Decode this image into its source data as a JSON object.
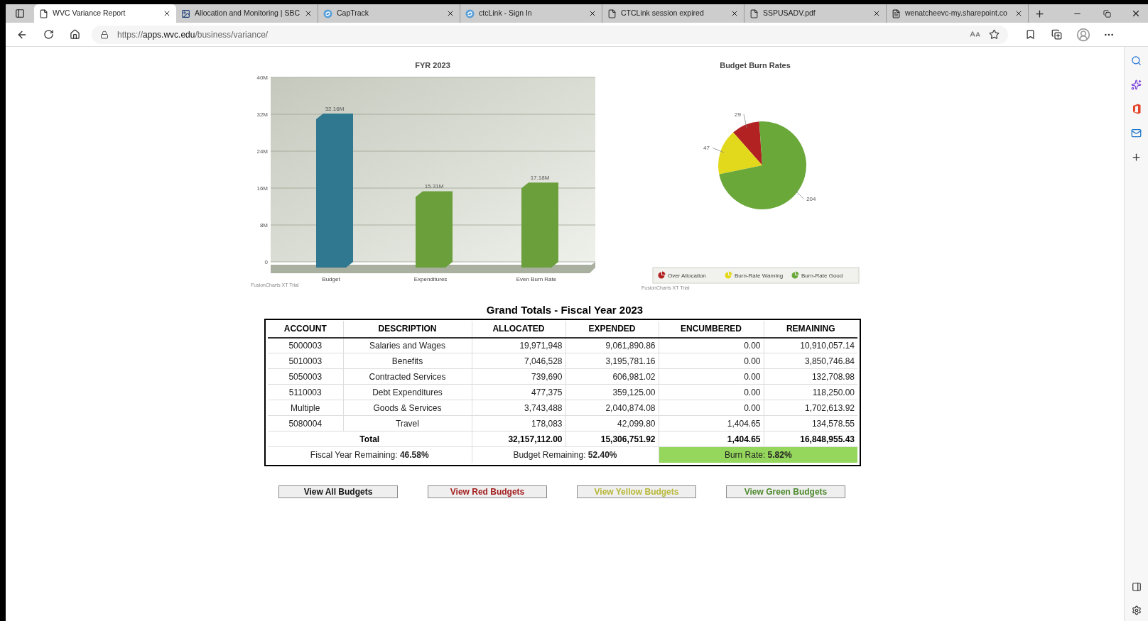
{
  "browser": {
    "tabs": [
      {
        "title": "WVC Variance Report",
        "selected": true,
        "kind": "page"
      },
      {
        "title": "Allocation and Monitoring | SBC",
        "selected": false,
        "kind": "image"
      },
      {
        "title": "CapTrack",
        "selected": false,
        "kind": "logo"
      },
      {
        "title": "ctcLink - Sign In",
        "selected": false,
        "kind": "logo"
      },
      {
        "title": "CTCLink session expired",
        "selected": false,
        "kind": "page"
      },
      {
        "title": "SSPUSADV.pdf",
        "selected": false,
        "kind": "page"
      },
      {
        "title": "wenatcheevc-my.sharepoint.co",
        "selected": false,
        "kind": "shared"
      }
    ],
    "url": {
      "scheme": "https://",
      "host": "apps.wvc.edu",
      "path": "/business/variance/"
    }
  },
  "bar_chart": {
    "credit": "FusionCharts XT Trial",
    "chart_data": {
      "type": "bar",
      "title": "FYR 2023",
      "grid": true,
      "categories": [
        "Budget",
        "Expenditures",
        "Even Burn Rate"
      ],
      "values": [
        32.16,
        15.31,
        17.18
      ],
      "ylim": [
        0,
        40
      ],
      "yticks": [
        {
          "value": 0,
          "label": "0"
        },
        {
          "value": 8,
          "label": "8M"
        },
        {
          "value": 16,
          "label": "16M"
        },
        {
          "value": 24,
          "label": "24M"
        },
        {
          "value": 32,
          "label": "32M"
        },
        {
          "value": 40,
          "label": "40M"
        }
      ],
      "value_labels": [
        "32.16M",
        "15.31M",
        "17.18M"
      ]
    }
  },
  "pie_chart": {
    "credit": "FusionCharts XT Trial",
    "slices": [
      {
        "color": "#b22222"
      },
      {
        "color": "#e3d91c"
      },
      {
        "color": "#6aa83a"
      }
    ],
    "chart_data": {
      "type": "pie",
      "title": "Budget Burn Rates",
      "categories": [
        "Over Allocation",
        "Burn-Rate Warning",
        "Burn-Rate Good"
      ],
      "values": [
        29,
        47,
        204
      ],
      "data_labels": true,
      "legend": "bottom"
    }
  },
  "table": {
    "title": "Grand Totals - Fiscal Year 2023",
    "columns": [
      "ACCOUNT",
      "DESCRIPTION",
      "ALLOCATED",
      "EXPENDED",
      "ENCUMBERED",
      "REMAINING"
    ],
    "rows": [
      [
        "5000003",
        "Salaries and Wages",
        "19,971,948",
        "9,061,890.86",
        "0.00",
        "10,910,057.14"
      ],
      [
        "5010003",
        "Benefits",
        "7,046,528",
        "3,195,781.16",
        "0.00",
        "3,850,746.84"
      ],
      [
        "5050003",
        "Contracted Services",
        "739,690",
        "606,981.02",
        "0.00",
        "132,708.98"
      ],
      [
        "5110003",
        "Debt Expenditures",
        "477,375",
        "359,125.00",
        "0.00",
        "118,250.00"
      ],
      [
        "Multiple",
        "Goods & Services",
        "3,743,488",
        "2,040,874.08",
        "0.00",
        "1,702,613.92"
      ],
      [
        "5080004",
        "Travel",
        "178,083",
        "42,099.80",
        "1,404.65",
        "134,578.55"
      ]
    ],
    "total": {
      "label": "Total",
      "values": [
        "32,157,112.00",
        "15,306,751.92",
        "1,404.65",
        "16,848,955.43"
      ]
    },
    "summary": [
      {
        "text": "Fiscal Year Remaining: **46.58%**",
        "highlighted": false
      },
      {
        "text": "Budget Remaining: **52.40%**",
        "highlighted": false
      },
      {
        "text": "Burn Rate: **5.82%**",
        "highlighted": true
      }
    ]
  },
  "buttons": [
    {
      "label": "View All Budgets",
      "color": "#111111"
    },
    {
      "label": "View Red Budgets",
      "color": "#a31f1f"
    },
    {
      "label": "View Yellow Budgets",
      "color": "#b8b83a"
    },
    {
      "label": "View Green Budgets",
      "color": "#4e8a2e"
    }
  ]
}
